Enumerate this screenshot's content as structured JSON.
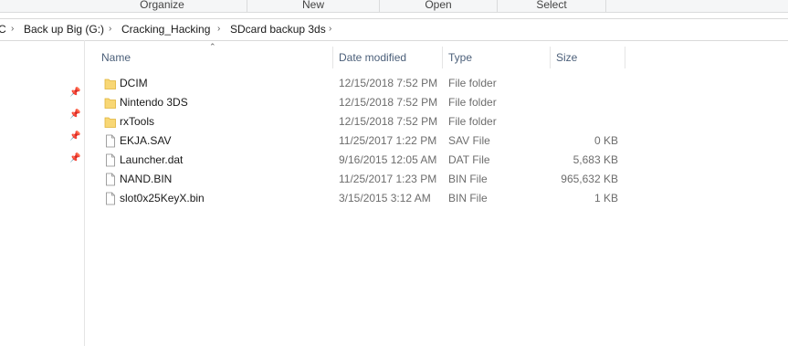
{
  "ribbon": {
    "groups": [
      "Organize",
      "New",
      "Open",
      "Select"
    ]
  },
  "address": {
    "crumbs": [
      "C",
      "Back up Big (G:)",
      "Cracking_Hacking",
      "SDcard backup 3ds"
    ]
  },
  "columns": {
    "name": "Name",
    "date": "Date modified",
    "type": "Type",
    "size": "Size"
  },
  "files": [
    {
      "name": "DCIM",
      "date": "12/15/2018 7:52 PM",
      "type": "File folder",
      "size": "",
      "icon": "folder-icon"
    },
    {
      "name": "Nintendo 3DS",
      "date": "12/15/2018 7:52 PM",
      "type": "File folder",
      "size": "",
      "icon": "folder-icon"
    },
    {
      "name": "rxTools",
      "date": "12/15/2018 7:52 PM",
      "type": "File folder",
      "size": "",
      "icon": "folder-icon"
    },
    {
      "name": "EKJA.SAV",
      "date": "11/25/2017 1:22 PM",
      "type": "SAV File",
      "size": "0 KB",
      "icon": "file-icon"
    },
    {
      "name": "Launcher.dat",
      "date": "9/16/2015 12:05 AM",
      "type": "DAT File",
      "size": "5,683 KB",
      "icon": "file-icon"
    },
    {
      "name": "NAND.BIN",
      "date": "11/25/2017 1:23 PM",
      "type": "BIN File",
      "size": "965,632 KB",
      "icon": "file-icon"
    },
    {
      "name": "slot0x25KeyX.bin",
      "date": "3/15/2015 3:12 AM",
      "type": "BIN File",
      "size": "1 KB",
      "icon": "file-icon"
    }
  ],
  "colors": {
    "folder": "#f8d775",
    "header_text": "#4c607a",
    "meta_text": "#6d6d6d"
  }
}
